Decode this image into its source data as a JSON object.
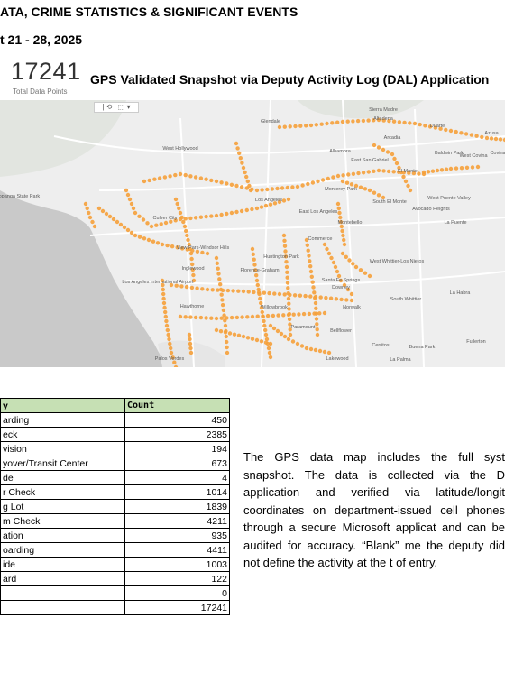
{
  "header": {
    "title": "ATA, CRIME STATISTICS & SIGNIFICANT EVENTS",
    "date_range": "t 21 - 28, 2025"
  },
  "kpi": {
    "value": "17241",
    "label": "Total Data Points"
  },
  "snapshot_title": "GPS Validated Snapshot via Deputy Activity Log (DAL) Application",
  "map": {
    "toolbar": "| ⟲ | ⬚ ▾",
    "dot_color": "#f5a03a",
    "labels": [
      "Glendale",
      "Sierra Madre",
      "Duarte",
      "Azusa",
      "Arcadia",
      "Altadena",
      "West Hollywood",
      "Alhambra",
      "East San Gabriel",
      "El Monte",
      "Baldwin Park",
      "West Covina",
      "Covina",
      "Monterey Park",
      "South El Monte",
      "Los Angeles",
      "East Los Angeles",
      "Culver City",
      "Montebello",
      "West Puente Valley",
      "Avocado Heights",
      "La Puente",
      "Commerce",
      "View Park-Windsor Hills",
      "Huntington Park",
      "Inglewood",
      "Florence-Graham",
      "West Whittier-Los Nietos",
      "Los Angeles International Airport",
      "Downey",
      "Santa Fe Springs",
      "Hawthorne",
      "Willowbrook",
      "Norwalk",
      "South Whittier",
      "La Habra",
      "Paramount",
      "Bellflower",
      "Fullerton",
      "Cerritos",
      "Buena Park",
      "Palos Verdes",
      "Lakewood",
      "La Palma",
      "Topanga State Park"
    ]
  },
  "table": {
    "headers": [
      "y",
      "Count"
    ],
    "rows": [
      {
        "activity": "arding",
        "count": "450"
      },
      {
        "activity": "eck",
        "count": "2385"
      },
      {
        "activity": "vision",
        "count": "194"
      },
      {
        "activity": "yover/Transit Center",
        "count": "673"
      },
      {
        "activity": "de",
        "count": "4"
      },
      {
        "activity": "r Check",
        "count": "1014"
      },
      {
        "activity": "g Lot",
        "count": "1839"
      },
      {
        "activity": "m Check",
        "count": "4211"
      },
      {
        "activity": "ation",
        "count": "935"
      },
      {
        "activity": "oarding",
        "count": "4411"
      },
      {
        "activity": "ide",
        "count": "1003"
      },
      {
        "activity": "ard",
        "count": "122"
      },
      {
        "activity": "",
        "count": "0"
      },
      {
        "activity": "",
        "count": "17241"
      }
    ]
  },
  "description": "The GPS data map includes the full syst snapshot. The data is collected via the D application and verified via latitude/longit coordinates on department-issued cell phones through a secure Microsoft applicat and can be audited for accuracy. “Blank” me the deputy did not define the activity at the t of entry."
}
